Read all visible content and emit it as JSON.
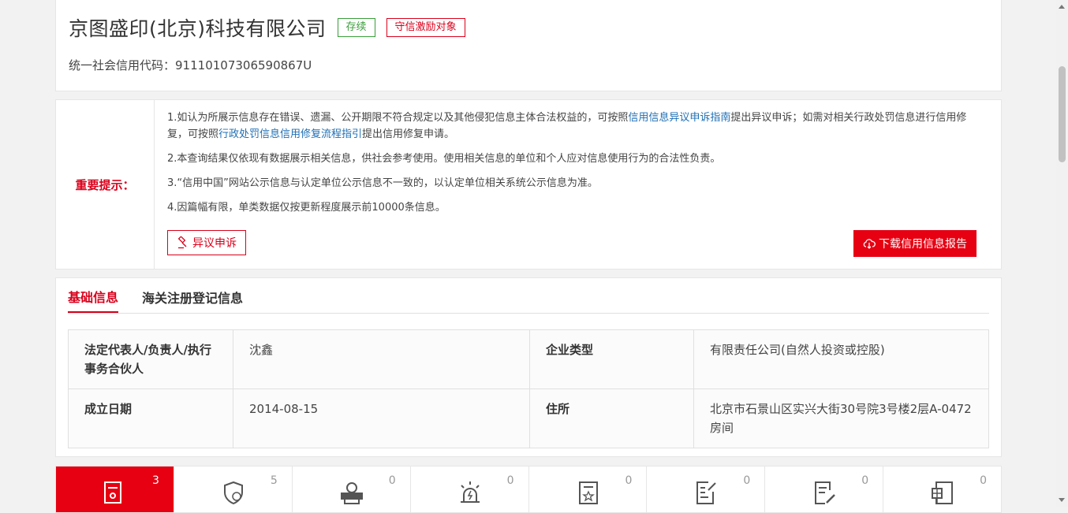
{
  "company": {
    "name": "京图盛印(北京)科技有限公司",
    "status_badge": "存续",
    "honor_badge": "守信激励对象",
    "credit_code_label": "统一社会信用代码：",
    "credit_code": "91110107306590867U"
  },
  "notice": {
    "label": "重要提示：",
    "line1_a": "1.如认为所展示信息存在错误、遗漏、公开期限不符合规定以及其他侵犯信息主体合法权益的，可按照",
    "line1_link1": "信用信息异议申诉指南",
    "line1_b": "提出异议申诉；如需对相关行政处罚信息进行信用修复，可按照",
    "line1_link2": "行政处罚信息信用修复流程指引",
    "line1_c": "提出信用修复申请。",
    "line2": "2.本查询结果仅依现有数据展示相关信息，供社会参考使用。使用相关信息的单位和个人应对信息使用行为的合法性负责。",
    "line3": "3.“信用中国”网站公示信息与认定单位公示信息不一致的，以认定单位相关系统公示信息为准。",
    "line4": "4.因篇幅有限，单类数据仅按更新程度展示前10000条信息。",
    "appeal_button": "异议申诉",
    "download_button": "下载信用信息报告"
  },
  "tabs": [
    {
      "label": "基础信息"
    },
    {
      "label": "海关注册登记信息"
    }
  ],
  "basic_info": {
    "legal_rep_label": "法定代表人/负责人/执行事务合伙人",
    "legal_rep": "沈鑫",
    "type_label": "企业类型",
    "type": "有限责任公司(自然人投资或控股)",
    "founded_label": "成立日期",
    "founded": "2014-08-15",
    "address_label": "住所",
    "address": "北京市石景山区实兴大街30号院3号楼2层A-0472房间"
  },
  "categories": [
    {
      "icon": "document-person-icon",
      "count": "3"
    },
    {
      "icon": "shield-credit-icon",
      "count": "5"
    },
    {
      "icon": "dishonest-person-icon",
      "count": "0"
    },
    {
      "icon": "alarm-light-icon",
      "count": "0"
    },
    {
      "icon": "certificate-icon",
      "count": "0"
    },
    {
      "icon": "checklist-icon",
      "count": "0"
    },
    {
      "icon": "document-pen-icon",
      "count": "0"
    },
    {
      "icon": "report-icon",
      "count": "0"
    }
  ],
  "colors": {
    "accent_red": "#e60012",
    "text_red": "#d9001b",
    "status_green": "#3a9e3a",
    "link_blue": "#1e6fb5"
  }
}
